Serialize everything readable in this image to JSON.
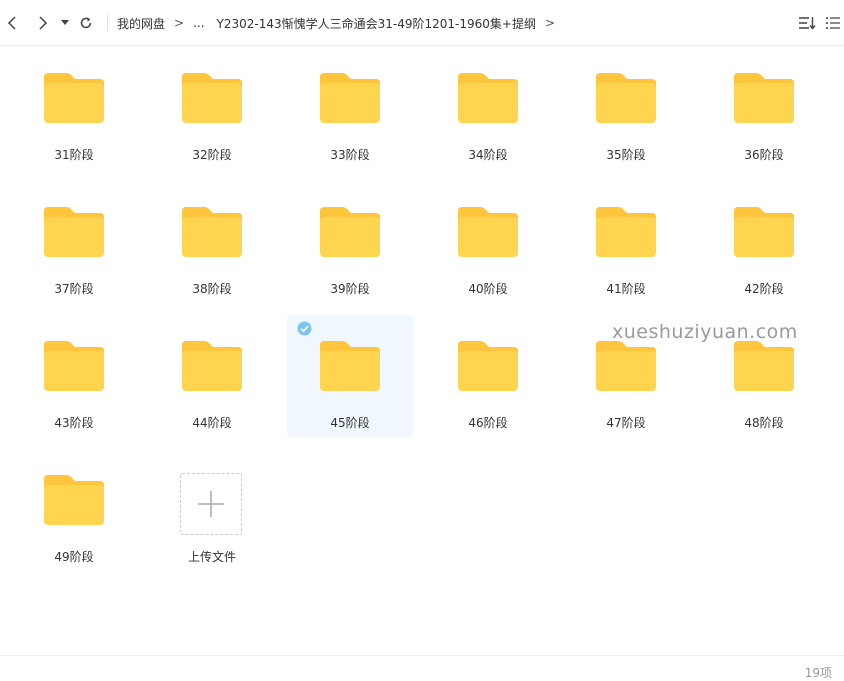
{
  "toolbar": {
    "back_icon": "chevron-left-icon",
    "forward_icon": "chevron-right-icon",
    "history_icon": "caret-down-icon",
    "refresh_icon": "refresh-icon",
    "sort_icon": "sort-icon",
    "list_view_icon": "list-view-icon"
  },
  "breadcrumb": {
    "root": "我的网盘",
    "ellipsis": "...",
    "current": "Y2302-143惭愧学人三命通会31-49阶1201-1960集+提纲",
    "separator": ">"
  },
  "folders": [
    {
      "label": "31阶段",
      "selected": false
    },
    {
      "label": "32阶段",
      "selected": false
    },
    {
      "label": "33阶段",
      "selected": false
    },
    {
      "label": "34阶段",
      "selected": false
    },
    {
      "label": "35阶段",
      "selected": false
    },
    {
      "label": "36阶段",
      "selected": false
    },
    {
      "label": "37阶段",
      "selected": false
    },
    {
      "label": "38阶段",
      "selected": false
    },
    {
      "label": "39阶段",
      "selected": false
    },
    {
      "label": "40阶段",
      "selected": false
    },
    {
      "label": "41阶段",
      "selected": false
    },
    {
      "label": "42阶段",
      "selected": false
    },
    {
      "label": "43阶段",
      "selected": false
    },
    {
      "label": "44阶段",
      "selected": false
    },
    {
      "label": "45阶段",
      "selected": true
    },
    {
      "label": "46阶段",
      "selected": false
    },
    {
      "label": "47阶段",
      "selected": false
    },
    {
      "label": "48阶段",
      "selected": false
    },
    {
      "label": "49阶段",
      "selected": false
    }
  ],
  "upload": {
    "label": "上传文件",
    "icon": "plus-icon"
  },
  "watermark": "xueshuziyuan.com",
  "status": {
    "count": "19项"
  },
  "colors": {
    "folder": "#ffd54f",
    "folder_tab": "#ffc53d",
    "selected_bg": "#f0f8fd",
    "check": "#7ec3ec"
  }
}
